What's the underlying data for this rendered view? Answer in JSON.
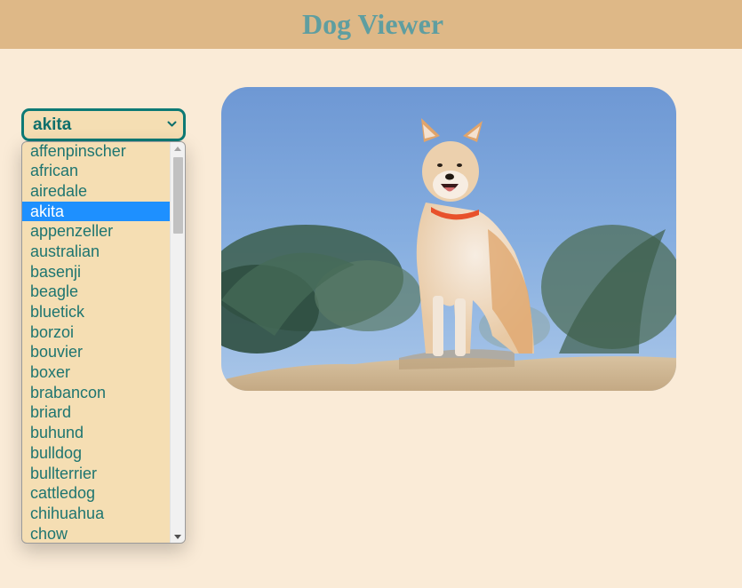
{
  "header": {
    "title": "Dog Viewer",
    "background": "#deb887",
    "title_color": "#5f9ea0"
  },
  "breed_select": {
    "selected": "akita",
    "icon": "chevron-down-icon",
    "options": [
      "affenpinscher",
      "african",
      "airedale",
      "akita",
      "appenzeller",
      "australian",
      "basenji",
      "beagle",
      "bluetick",
      "borzoi",
      "bouvier",
      "boxer",
      "brabancon",
      "briard",
      "buhund",
      "bulldog",
      "bullterrier",
      "cattledog",
      "chihuahua",
      "chow"
    ]
  },
  "photo": {
    "subject": "akita dog standing on sand",
    "icon": "dog-photo"
  },
  "colors": {
    "page_background": "#faebd7",
    "select_background": "#f5deb3",
    "select_border": "#0d7a75",
    "option_text": "#1e7570",
    "highlight": "#1e90ff"
  }
}
